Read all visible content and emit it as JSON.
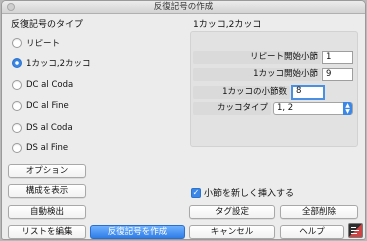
{
  "window": {
    "title": "反復記号の作成"
  },
  "left": {
    "heading": "反復記号のタイプ",
    "options": [
      {
        "label": "リピート",
        "selected": false
      },
      {
        "label": "1カッコ,2カッコ",
        "selected": true
      },
      {
        "label": "DC al Coda",
        "selected": false
      },
      {
        "label": "DC al Fine",
        "selected": false
      },
      {
        "label": "DS al Coda",
        "selected": false
      },
      {
        "label": "DS al Fine",
        "selected": false
      }
    ]
  },
  "right": {
    "heading": "1カッコ,2カッコ",
    "fields": {
      "repeat_start_label": "リピート開始小節",
      "repeat_start_value": "1",
      "bracket1_start_label": "1カッコ開始小節",
      "bracket1_start_value": "9",
      "bracket1_bars_label": "1カッコの小節数",
      "bracket1_bars_value": "8",
      "bracket_type_label": "カッコタイプ",
      "bracket_type_value": "1, 2"
    }
  },
  "checkbox": {
    "label": "小節を新しく挿入する",
    "checked": true
  },
  "buttons": {
    "options": "オプション",
    "show_structure": "構成を表示",
    "auto_detect": "自動検出",
    "edit_list": "リストを編集",
    "create": "反復記号を作成",
    "tag_settings": "タグ設定",
    "delete_all": "全部削除",
    "cancel": "キャンセル",
    "help": "ヘルプ"
  },
  "colors": {
    "accent": "#3a87e8",
    "window_bg": "#ececec",
    "panel_bg": "#e2e2e2"
  }
}
